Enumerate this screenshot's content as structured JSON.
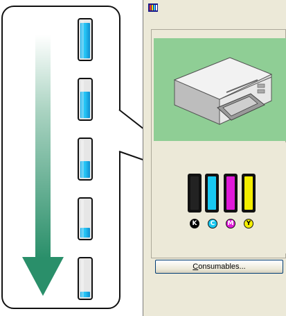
{
  "diagram": {
    "levels": [
      {
        "name": "full",
        "level": 0.95
      },
      {
        "name": "high",
        "level": 0.7
      },
      {
        "name": "medium",
        "level": 0.45
      },
      {
        "name": "low",
        "level": 0.25
      },
      {
        "name": "very-low",
        "level": 0.15
      }
    ],
    "arrow_color": "#2a8f6a"
  },
  "window": {
    "inks": [
      {
        "name": "black",
        "letter": "K",
        "color": "#222222",
        "level": 1.0,
        "badge_bg": "#000000",
        "badge_fg": "#ffffff"
      },
      {
        "name": "cyan",
        "letter": "C",
        "color": "#18c8f0",
        "level": 1.0,
        "badge_bg": "#18c8f0",
        "badge_fg": "#ffffff"
      },
      {
        "name": "magenta",
        "letter": "M",
        "color": "#e01ad8",
        "level": 1.0,
        "badge_bg": "#e01ad8",
        "badge_fg": "#ffffff"
      },
      {
        "name": "yellow",
        "letter": "Y",
        "color": "#f4ee00",
        "level": 1.0,
        "badge_bg": "#f4ee00",
        "badge_fg": "#000000"
      }
    ],
    "consumables_label_u": "C",
    "consumables_label_rest": "onsumables..."
  }
}
